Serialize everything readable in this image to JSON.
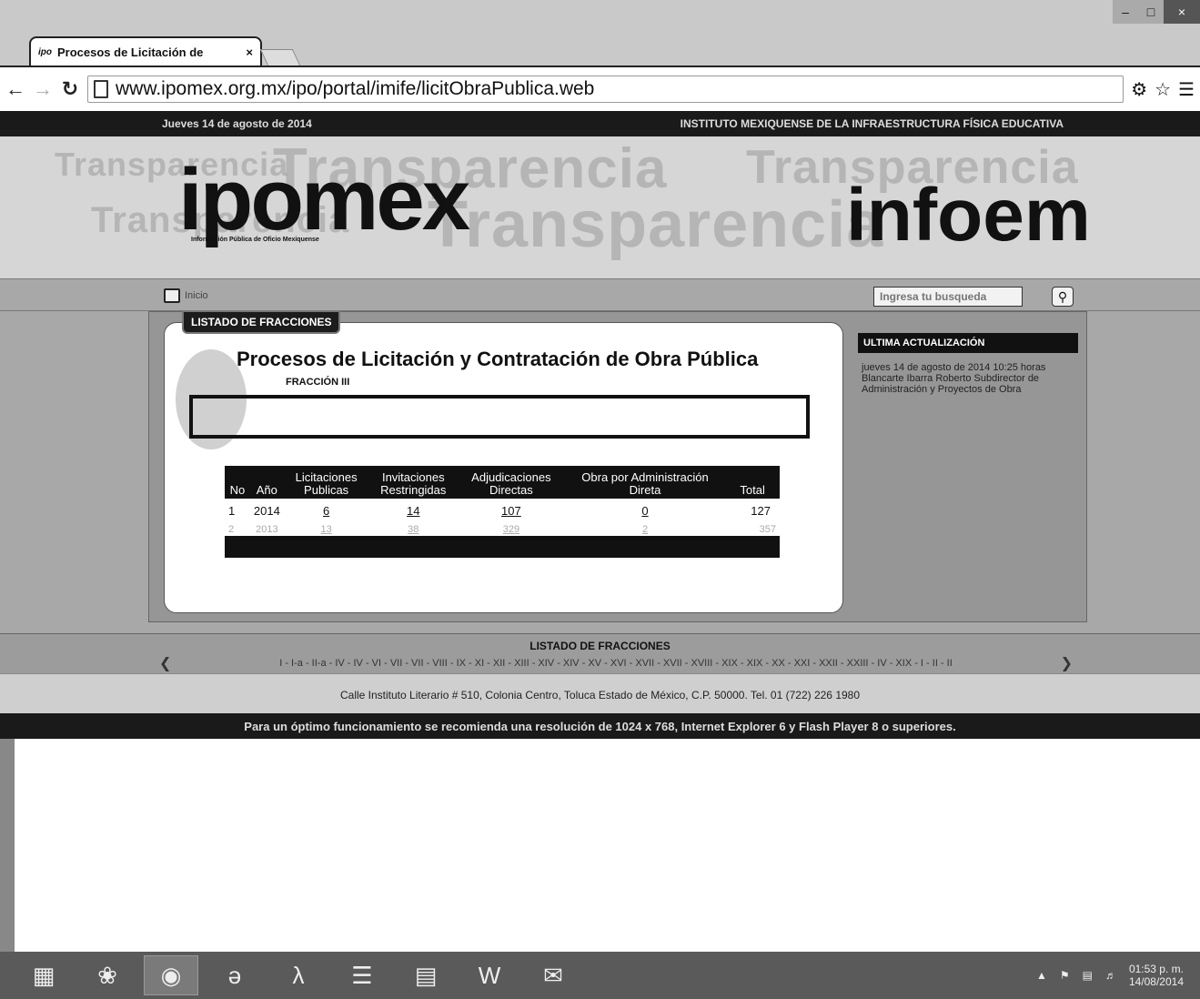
{
  "browser": {
    "tab_title": "Procesos de Licitación de",
    "tab_favicon": "ipo",
    "tab_close": "×",
    "url": "www.ipomex.org.mx/ipo/portal/imife/licitObraPublica.web"
  },
  "site": {
    "date": "Jueves 14 de agosto de 2014",
    "institution": "INSTITUTO MEXIQUENSE DE LA INFRAESTRUCTURA FÍSICA EDUCATIVA",
    "logo_left": "ipomex",
    "logo_left_sub": "Información Pública de Oficio Mexiquense",
    "logo_right": "infoem",
    "watermark": [
      "Transparencia",
      "Transparencia",
      "Transparencia",
      "Transparencia",
      "Transparencia"
    ],
    "home_label": "Inicio",
    "search_placeholder": "Ingresa tu busqueda"
  },
  "card": {
    "tab_label": "LISTADO DE FRACCIONES",
    "title": "Procesos de Licitación y Contratación de Obra Pública",
    "subtitle": "FRACCIÓN III"
  },
  "table": {
    "headers": [
      "No",
      "Año",
      "Licitaciones Publicas",
      "Invitaciones Restringidas",
      "Adjudicaciones Directas",
      "Obra por Administración Direta",
      "Total"
    ],
    "rows": [
      {
        "no": "1",
        "year": "2014",
        "licitaciones": "6",
        "invitaciones": "14",
        "adjudicaciones": "107",
        "obra": "0",
        "total": "127"
      },
      {
        "no": "2",
        "year": "2013",
        "licitaciones": "13",
        "invitaciones": "38",
        "adjudicaciones": "329",
        "obra": "2",
        "total": "357"
      }
    ]
  },
  "update": {
    "heading": "ULTIMA ACTUALIZACIÓN",
    "when": "jueves 14 de agosto de 2014 10:25 horas",
    "who": "Blancarte Ibarra Roberto Subdirector de Administración y Proyectos de Obra"
  },
  "fracciones": {
    "title": "LISTADO DE FRACCIONES",
    "items": "I - I-a - II-a - IV - IV - VI - VII - VII - VIII - IX - XI - XII - XIII - XIV - XIV - XV - XVI - XVII - XVII - XVIII - XIX - XIX - XX - XXI - XXII - XXIII - IV - XIX - I - II - II"
  },
  "footer": {
    "address": "Calle Instituto Literario # 510, Colonia Centro, Toluca Estado de México, C.P. 50000. Tel. 01 (722) 226 1980",
    "recommendation": "Para un óptimo funcionamiento se recomienda una resolución de 1024 x 768, Internet Explorer 6 y Flash Player 8 o superiores."
  },
  "taskbar": {
    "icons": [
      "calculator-icon",
      "paint-icon",
      "chrome-icon",
      "ie-icon",
      "acrobat-icon",
      "explorer-icon",
      "folder-icon",
      "word-icon",
      "mail-icon"
    ],
    "time": "01:53 p. m.",
    "date": "14/08/2014"
  }
}
